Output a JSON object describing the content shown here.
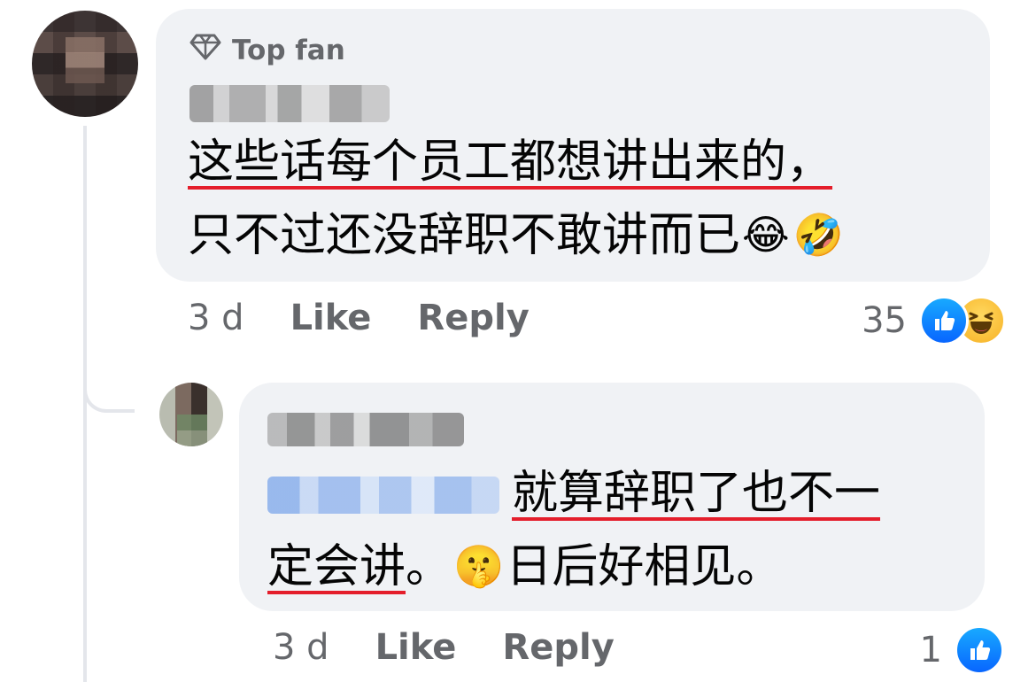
{
  "comment": {
    "badge_label": "Top fan",
    "text_line1": "这些话每个员工都想讲出来的，",
    "text_line2": "只不过还没辞职不敢讲而已",
    "emoji_1": "😂",
    "emoji_2": "🤣",
    "time": "3 d",
    "like_label": "Like",
    "reply_label": "Reply",
    "reaction_count": "35",
    "reactions": [
      "like-icon",
      "haha-icon"
    ]
  },
  "reply": {
    "text_line1": "就算辞职了也不一",
    "text_line2_a": "定会讲",
    "text_line2_b": "。",
    "emoji": "🤫",
    "text_line2_c": "日后好相见。",
    "time": "3 d",
    "like_label": "Like",
    "reply_label": "Reply",
    "reaction_count": "1",
    "reactions": [
      "like-icon"
    ]
  },
  "colors": {
    "bubble": "#f0f2f5",
    "secondary_text": "#65676b",
    "underline": "#e41e2b",
    "like_blue": "#0866ff"
  }
}
